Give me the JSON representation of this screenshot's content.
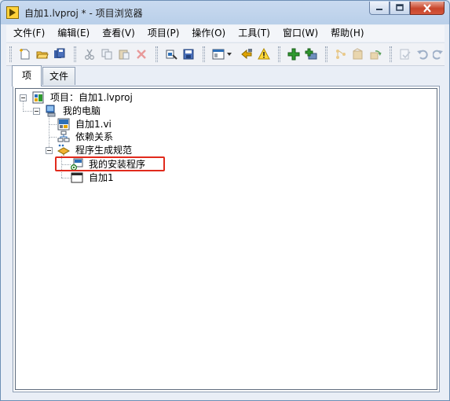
{
  "window": {
    "title": "自加1.lvproj * - 项目浏览器",
    "app_icon": "labview-run-arrow-icon"
  },
  "menu": [
    "文件(F)",
    "编辑(E)",
    "查看(V)",
    "项目(P)",
    "操作(O)",
    "工具(T)",
    "窗口(W)",
    "帮助(H)"
  ],
  "toolbar": {
    "icons": [
      "new-icon",
      "open-icon",
      "save-all-icon",
      "cut-icon",
      "copy-icon",
      "paste-icon",
      "delete-icon",
      "build-icon",
      "save-icon",
      "view-icon",
      "dropdown-icon",
      "resolve-icon",
      "warning-icon",
      "add-icon",
      "add-folder-icon",
      "source-control-icon",
      "deploy-icon",
      "refresh-icon",
      "checkout-icon",
      "undo-icon",
      "redo-icon"
    ]
  },
  "tabs": [
    {
      "label": "项",
      "active": true
    },
    {
      "label": "文件",
      "active": false
    }
  ],
  "tree": {
    "project": "项目：自加1.lvproj",
    "computer": "我的电脑",
    "vi": "自加1.vi",
    "dependencies": "依赖关系",
    "build_specs": "程序生成规范",
    "installer": "我的安装程序",
    "application": "自加1"
  },
  "colors": {
    "highlight": "#e12a1c",
    "accent": "#1f7a1f"
  }
}
